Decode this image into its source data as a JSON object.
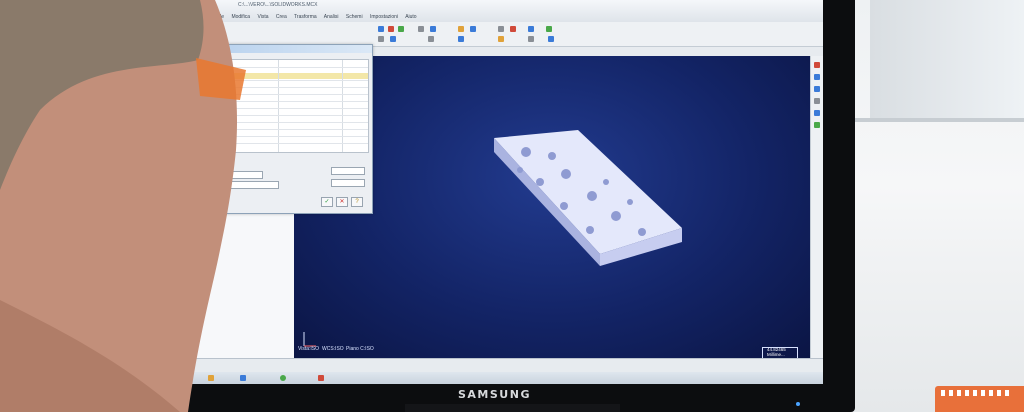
{
  "monitor": {
    "brand": "SAMSUNG"
  },
  "cad_app": {
    "title_path": "C:\\...\\VERO\\...\\SOLIDWORKS.MCX",
    "menu": [
      "File",
      "Modifica",
      "Vista",
      "Crea",
      "Trasforma",
      "Analisi",
      "Schemi",
      "Impostazioni",
      "Aiuto"
    ],
    "viewport": {
      "view_label": "Vista:ISO",
      "wcs_label": "WCS:ISO",
      "plane_label": "Piano C:ISO",
      "scale_value": "44.82465",
      "scale_unit": "Millime..."
    },
    "colors": {
      "viewport_bg": "#132466",
      "part_face": "#dde2f8"
    }
  }
}
